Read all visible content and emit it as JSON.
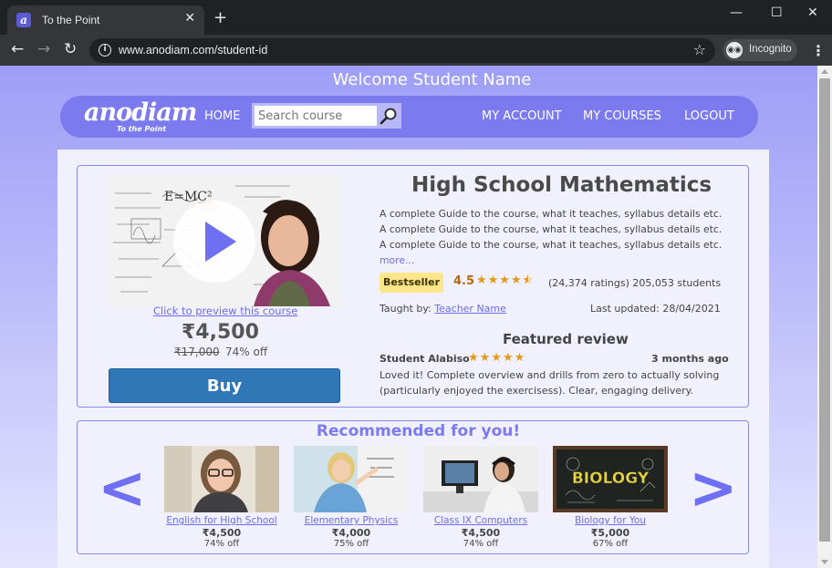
{
  "browser": {
    "tab_title": "To the Point",
    "url": "www.anodiam.com/student-id",
    "incognito_label": "Incognito"
  },
  "page": {
    "welcome": "Welcome Student Name",
    "logo": {
      "main": "anodiam",
      "sub": "To the Point"
    },
    "nav": {
      "home": "HOME",
      "search_placeholder": "Search course",
      "my_account": "MY ACCOUNT",
      "my_courses": "MY COURSES",
      "logout": "LOGOUT"
    },
    "course": {
      "title": "High School Mathematics",
      "description": [
        "A complete Guide to the course, what it teaches, syllabus details etc.",
        "A complete Guide to the course, what it teaches, syllabus details etc.",
        "A complete Guide to the course, what it teaches, syllabus details etc."
      ],
      "more": "more...",
      "preview_link": "Click to preview this course",
      "price": "₹4,500",
      "original_price": "₹17,000",
      "discount": "74% off",
      "buy_label": "Buy",
      "badge": "Bestseller",
      "rating": "4.5",
      "rating_value": 4.5,
      "ratings_text": "(24,374 ratings)  205,053 students",
      "taught_by_label": "Taught by:",
      "teacher": "Teacher Name",
      "last_updated": "Last updated: 28/04/2021"
    },
    "review": {
      "heading": "Featured review",
      "reviewer": "Student Alabiso",
      "stars": 5,
      "time": "3 months ago",
      "text": "Loved it! Complete overview and drills from zero to actually solving (particularly enjoyed the exercisess). Clear, engaging delivery."
    },
    "recommended": {
      "heading": "Recommended for you!",
      "prev": "<",
      "next": ">",
      "items": [
        {
          "name": "English for High School",
          "price": "₹4,500",
          "off": "74% off"
        },
        {
          "name": "Elementary Physics",
          "price": "₹4,000",
          "off": "75% off"
        },
        {
          "name": "Class IX Computers",
          "price": "₹4,500",
          "off": "74% off"
        },
        {
          "name": "Biology for You",
          "price": "₹5,000",
          "off": "67% off",
          "image_text": "BIOLOGY"
        }
      ]
    }
  },
  "colors": {
    "accent": "#7b7bef",
    "buy_button": "#2f77b7",
    "star": "#e59819",
    "badge": "#fde68a"
  }
}
